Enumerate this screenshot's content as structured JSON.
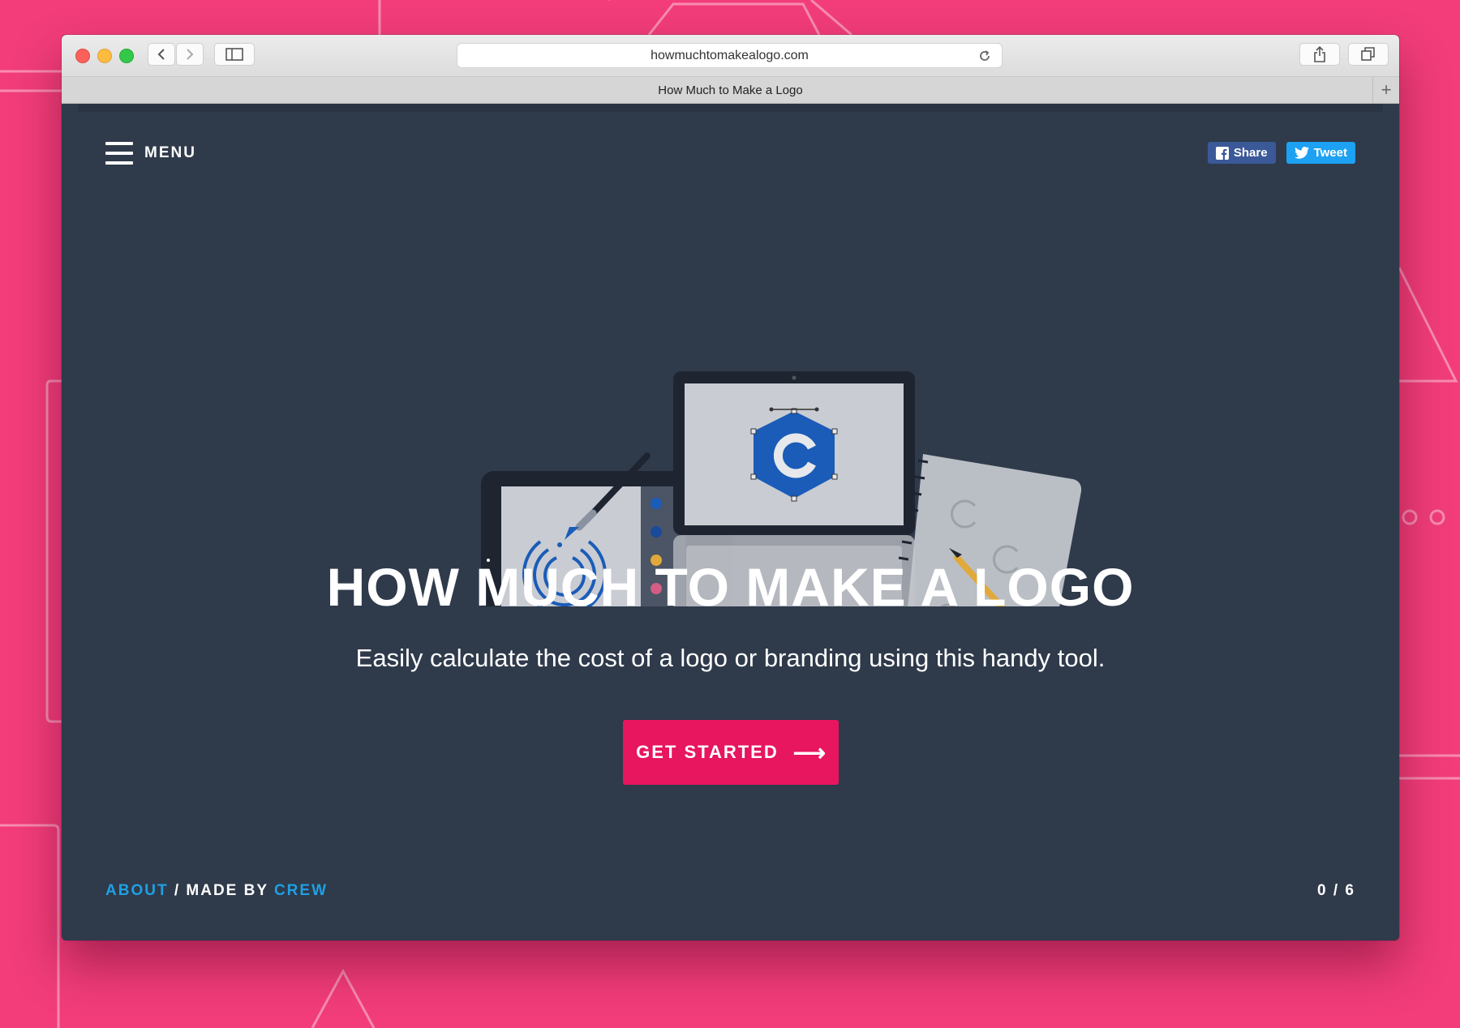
{
  "browser": {
    "url": "howmuchtomakealogo.com",
    "tab_title": "How Much to Make a Logo",
    "new_tab_label": "+"
  },
  "header": {
    "menu_label": "MENU",
    "share_label": "Share",
    "tweet_label": "Tweet"
  },
  "hero": {
    "title": "HOW MUCH TO MAKE A LOGO",
    "subtitle": "Easily calculate the cost of a logo or branding using this handy tool.",
    "cta_label": "GET STARTED",
    "cta_arrow": "⟶",
    "logo_letter": "C"
  },
  "footer": {
    "about_label": "ABOUT",
    "separator": " / MADE BY ",
    "crew_label": "CREW",
    "progress": "0 / 6"
  },
  "colors": {
    "background": "#f23d7a",
    "page": "#2f3a4b",
    "accent": "#e8155f",
    "link": "#1fa0e2",
    "facebook": "#3b5998",
    "twitter": "#1da1f2"
  }
}
